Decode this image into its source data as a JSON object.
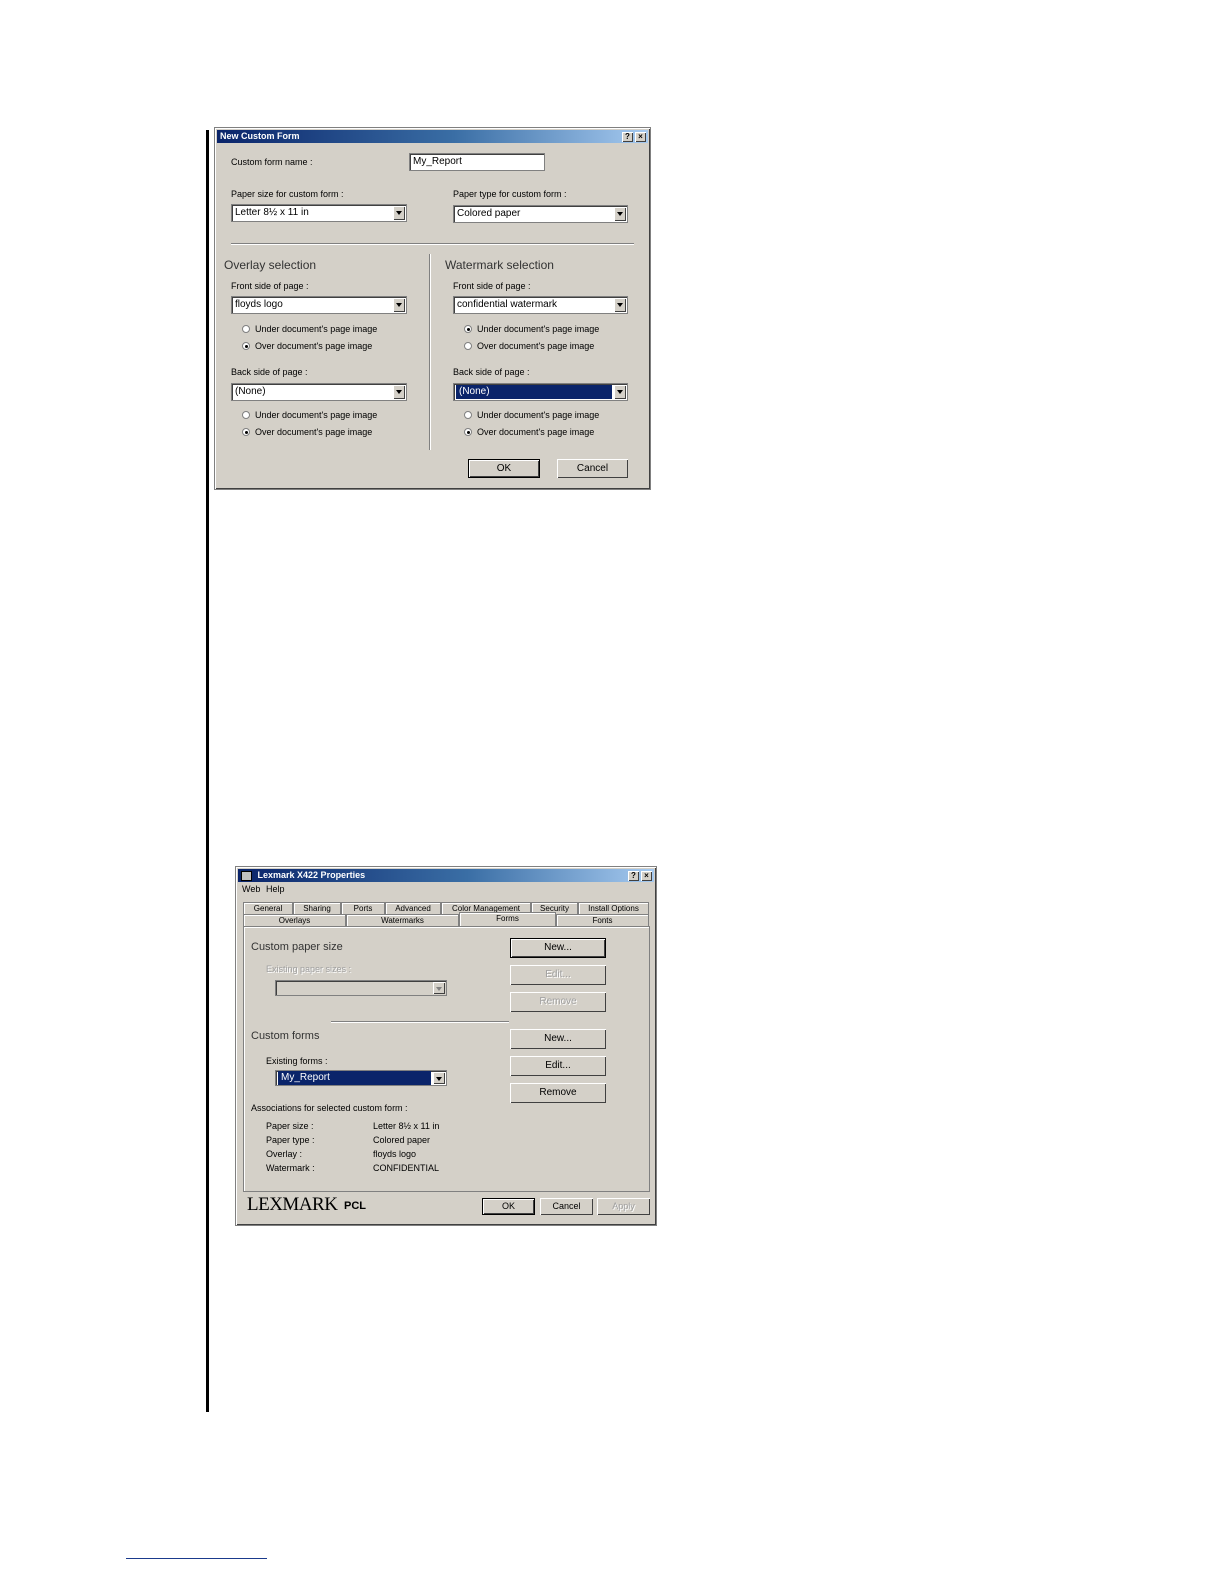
{
  "dialog1": {
    "title": "New Custom Form",
    "help_btn": "?",
    "close_btn": "×",
    "form_name_label": "Custom form name :",
    "form_name_value": "My_Report",
    "paper_size_label": "Paper size for custom form :",
    "paper_size_value": "Letter 8½ x 11 in",
    "paper_type_label": "Paper type for custom form :",
    "paper_type_value": "Colored paper",
    "overlay": {
      "heading": "Overlay selection",
      "front_label": "Front side of page :",
      "front_value": "floyds logo",
      "front_under": "Under document's page image",
      "front_over": "Over document's page image",
      "back_label": "Back side of page :",
      "back_value": "(None)",
      "back_under": "Under document's page image",
      "back_over": "Over document's page image"
    },
    "watermark": {
      "heading": "Watermark selection",
      "front_label": "Front side of page :",
      "front_value": "confidential watermark",
      "front_under": "Under document's page image",
      "front_over": "Over document's page image",
      "back_label": "Back side of page :",
      "back_value": "(None)",
      "back_under": "Under document's page image",
      "back_over": "Over document's page image"
    },
    "ok": "OK",
    "cancel": "Cancel"
  },
  "dialog2": {
    "title": "Lexmark X422 Properties",
    "help_btn": "?",
    "close_btn": "×",
    "menu": [
      "Web",
      "Help"
    ],
    "tabs_row1": [
      "General",
      "Sharing",
      "Ports",
      "Advanced",
      "Color Management",
      "Security",
      "Install Options"
    ],
    "tabs_row2": [
      "Overlays",
      "Watermarks",
      "Forms",
      "Fonts"
    ],
    "custom_paper_heading": "Custom paper size",
    "existing_sizes_label": "Existing paper sizes :",
    "paper_new": "New...",
    "paper_edit": "Edit...",
    "paper_remove": "Remove",
    "custom_forms_heading": "Custom forms",
    "existing_forms_label": "Existing forms :",
    "existing_forms_value": "My_Report",
    "forms_new": "New...",
    "forms_edit": "Edit...",
    "forms_remove": "Remove",
    "assoc_heading": "Associations for selected custom form :",
    "assoc": [
      {
        "label": "Paper size :",
        "value": "Letter 8½ x 11 in"
      },
      {
        "label": "Paper type :",
        "value": "Colored paper"
      },
      {
        "label": "Overlay :",
        "value": "floyds logo"
      },
      {
        "label": "Watermark :",
        "value": "CONFIDENTIAL"
      }
    ],
    "brand": "LEXMARK",
    "brand_suffix": "PCL",
    "ok": "OK",
    "cancel": "Cancel",
    "apply": "Apply"
  }
}
